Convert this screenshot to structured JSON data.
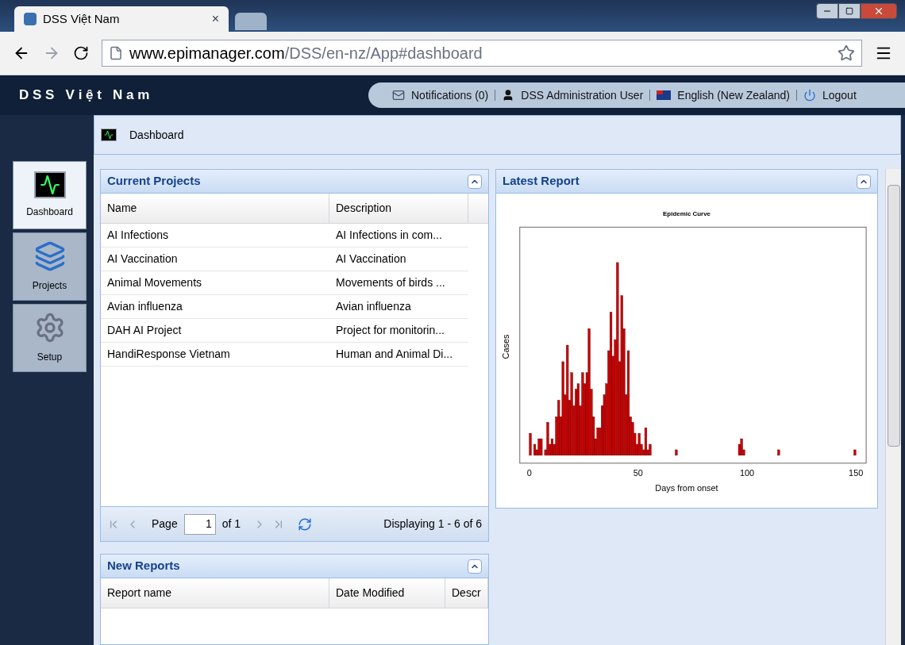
{
  "browser": {
    "tab_title": "DSS Việt Nam",
    "tab_close": "×",
    "address_host": "www.epimanager.com",
    "address_path": "/DSS/en-nz/App#dashboard"
  },
  "header": {
    "title": "D S S   V i ệ t   N a m",
    "notifications": "Notifications (0)",
    "user": "DSS Administration User",
    "language": "English (New Zealand)",
    "logout": "Logout"
  },
  "breadcrumb": "Dashboard",
  "nav": [
    {
      "label": "Dashboard",
      "kind": "dashboard",
      "selected": true
    },
    {
      "label": "Projects",
      "kind": "projects",
      "selected": false
    },
    {
      "label": "Setup",
      "kind": "setup",
      "selected": false
    }
  ],
  "projects_panel": {
    "title": "Current Projects",
    "columns": [
      "Name",
      "Description"
    ],
    "rows": [
      [
        "AI Infections",
        "AI Infections in com..."
      ],
      [
        "AI Vaccination",
        "AI Vaccination"
      ],
      [
        "Animal Movements",
        "Movements of birds ..."
      ],
      [
        "Avian influenza",
        "Avian influenza"
      ],
      [
        "DAH AI Project",
        "Project for monitorin..."
      ],
      [
        "HandiResponse Vietnam",
        "Human and Animal Di..."
      ]
    ],
    "pager": {
      "page_label": "Page",
      "page": "1",
      "of": "of 1",
      "display": "Displaying 1 - 6 of 6"
    }
  },
  "reports_panel": {
    "title": "New Reports",
    "columns": [
      "Report name",
      "Date Modified",
      "Descr"
    ]
  },
  "latest_panel": {
    "title": "Latest Report",
    "chart": {
      "title": "Epidemic Curve",
      "xlabel": "Days from onset",
      "ylabel": "Cases",
      "xticks": [
        "0",
        "50",
        "100",
        "150"
      ]
    }
  }
}
